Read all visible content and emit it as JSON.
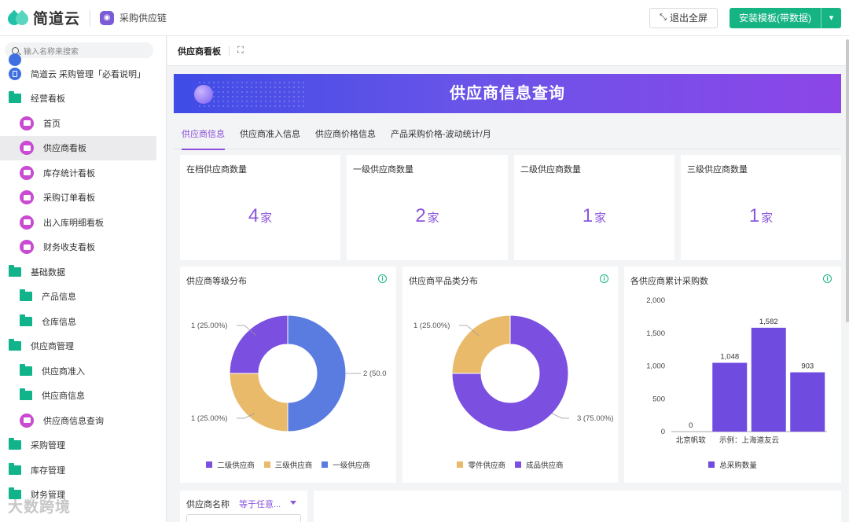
{
  "topbar": {
    "logo_text": "简道云",
    "app_icon": "supply-chain-icon",
    "app_name": "采购供应链",
    "exit_label": "退出全屏",
    "install_label": "安装模板(带数据)"
  },
  "sidebar": {
    "search_placeholder": "输入名称来搜索",
    "items": [
      {
        "label": "简道云 采购管理「必看说明」",
        "icon": "doc-icon",
        "level": 0
      },
      {
        "label": "经营看板",
        "icon": "folder-icon",
        "level": 0
      },
      {
        "label": "首页",
        "icon": "dashboard-icon",
        "level": 1
      },
      {
        "label": "供应商看板",
        "icon": "dashboard-icon",
        "level": 1,
        "active": true
      },
      {
        "label": "库存统计看板",
        "icon": "dashboard-icon",
        "level": 1
      },
      {
        "label": "采购订单看板",
        "icon": "dashboard-icon",
        "level": 1
      },
      {
        "label": "出入库明细看板",
        "icon": "dashboard-icon",
        "level": 1
      },
      {
        "label": "财务收支看板",
        "icon": "dashboard-icon",
        "level": 1
      },
      {
        "label": "基础数据",
        "icon": "folder-icon",
        "level": 0
      },
      {
        "label": "产品信息",
        "icon": "folder-icon",
        "level": 1
      },
      {
        "label": "仓库信息",
        "icon": "folder-icon",
        "level": 1
      },
      {
        "label": "供应商管理",
        "icon": "folder-icon",
        "level": 0
      },
      {
        "label": "供应商准入",
        "icon": "folder-icon",
        "level": 1
      },
      {
        "label": "供应商信息",
        "icon": "folder-icon",
        "level": 1
      },
      {
        "label": "供应商信息查询",
        "icon": "dashboard-icon",
        "level": 1
      },
      {
        "label": "采购管理",
        "icon": "folder-icon",
        "level": 0
      },
      {
        "label": "库存管理",
        "icon": "folder-icon",
        "level": 0
      },
      {
        "label": "财务管理",
        "icon": "folder-icon",
        "level": 0
      }
    ],
    "watermark": "大数跨境"
  },
  "main": {
    "page_title": "供应商看板",
    "banner_title": "供应商信息查询",
    "subtabs": [
      "供应商信息",
      "供应商准入信息",
      "供应商价格信息",
      "产品采购价格-波动统计/月"
    ],
    "stat_cards": [
      {
        "title": "在档供应商数量",
        "value": "4",
        "unit": "家"
      },
      {
        "title": "一级供应商数量",
        "value": "2",
        "unit": "家"
      },
      {
        "title": "二级供应商数量",
        "value": "1",
        "unit": "家"
      },
      {
        "title": "三级供应商数量",
        "value": "1",
        "unit": "家"
      }
    ],
    "filter": {
      "label": "供应商名称",
      "operator": "等于任意..."
    }
  },
  "colors": {
    "accent": "#8a56dd",
    "green": "#16b483",
    "purple": "#7b4fe0",
    "blue": "#5a7be0",
    "orange": "#eaba6b"
  },
  "chart_data": [
    {
      "type": "pie",
      "title": "供应商等级分布",
      "categories": [
        "二级供应商",
        "三级供应商",
        "一级供应商"
      ],
      "values": [
        1,
        1,
        2
      ],
      "labels": [
        "1 (25.00%)",
        "1 (25.00%)",
        "2 (50.0"
      ],
      "colors": [
        "#7b4fe0",
        "#eaba6b",
        "#5a7be0"
      ],
      "legend": "bottom"
    },
    {
      "type": "pie",
      "title": "供应商平品类分布",
      "categories": [
        "零件供应商",
        "成品供应商"
      ],
      "values": [
        1,
        3
      ],
      "labels": [
        "1 (25.00%)",
        "3 (75.00%)"
      ],
      "colors": [
        "#eaba6b",
        "#7b4fe0"
      ],
      "legend": "bottom"
    },
    {
      "type": "bar",
      "title": "各供应商累计采购数",
      "categories": [
        "北京帆软",
        "",
        "示例：上海道友云",
        ""
      ],
      "values": [
        0,
        1048,
        1582,
        903
      ],
      "value_labels": [
        "0",
        "1,048",
        "1,582",
        "903"
      ],
      "series": [
        {
          "name": "总采购数量",
          "values": [
            0,
            1048,
            1582,
            903
          ]
        }
      ],
      "yticks": [
        "0",
        "500",
        "1,000",
        "1,500",
        "2,000"
      ],
      "ylim": [
        0,
        2000
      ],
      "color": "#6f4be0",
      "legend": "bottom"
    }
  ]
}
